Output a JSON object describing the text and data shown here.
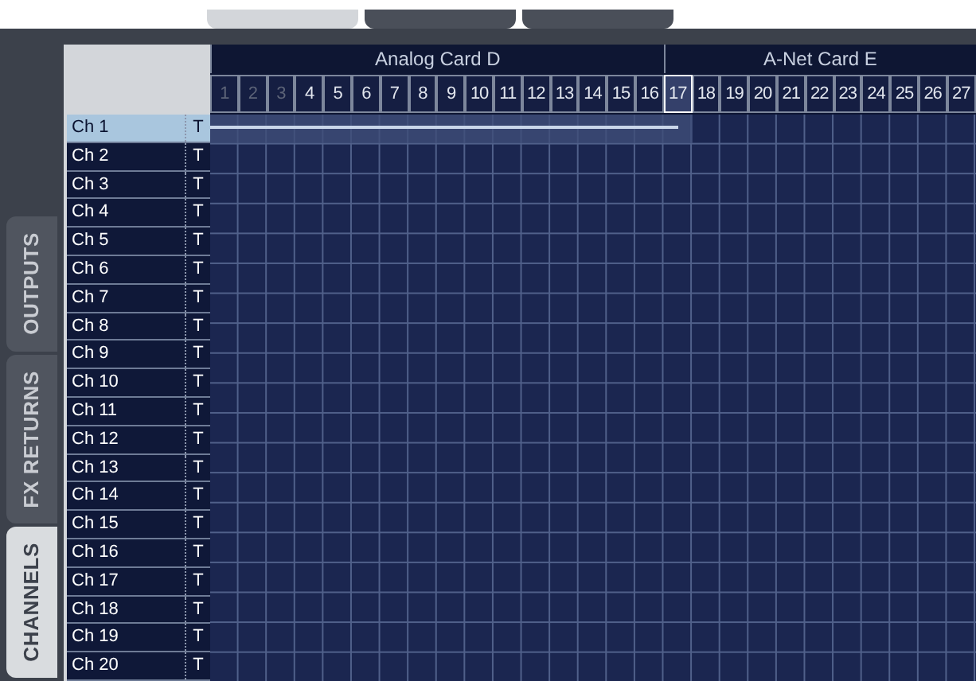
{
  "top_tabs": [
    {
      "selected": true
    },
    {
      "selected": false
    },
    {
      "selected": false
    }
  ],
  "side_tabs": [
    {
      "label": "OUTPUTS",
      "selected": false
    },
    {
      "label": "FX RETURNS",
      "selected": false
    },
    {
      "label": "CHANNELS",
      "selected": true
    }
  ],
  "cards": [
    {
      "label": "Analog Card D",
      "columns": [
        {
          "label": "1",
          "disabled": true,
          "selected": false
        },
        {
          "label": "2",
          "disabled": true,
          "selected": false
        },
        {
          "label": "3",
          "disabled": true,
          "selected": false
        },
        {
          "label": "4",
          "disabled": false,
          "selected": false
        },
        {
          "label": "5",
          "disabled": false,
          "selected": false
        },
        {
          "label": "6",
          "disabled": false,
          "selected": false
        },
        {
          "label": "7",
          "disabled": false,
          "selected": false
        },
        {
          "label": "8",
          "disabled": false,
          "selected": false
        },
        {
          "label": "9",
          "disabled": false,
          "selected": false
        },
        {
          "label": "10",
          "disabled": false,
          "selected": false
        },
        {
          "label": "11",
          "disabled": false,
          "selected": false
        },
        {
          "label": "12",
          "disabled": false,
          "selected": false
        },
        {
          "label": "13",
          "disabled": false,
          "selected": false
        },
        {
          "label": "14",
          "disabled": false,
          "selected": false
        },
        {
          "label": "15",
          "disabled": false,
          "selected": false
        },
        {
          "label": "16",
          "disabled": false,
          "selected": false
        }
      ]
    },
    {
      "label": "A-Net Card E",
      "columns": [
        {
          "label": "17",
          "disabled": false,
          "selected": true
        },
        {
          "label": "18",
          "disabled": false,
          "selected": false
        },
        {
          "label": "19",
          "disabled": false,
          "selected": false
        },
        {
          "label": "20",
          "disabled": false,
          "selected": false
        },
        {
          "label": "21",
          "disabled": false,
          "selected": false
        },
        {
          "label": "22",
          "disabled": false,
          "selected": false
        },
        {
          "label": "23",
          "disabled": false,
          "selected": false
        },
        {
          "label": "24",
          "disabled": false,
          "selected": false
        },
        {
          "label": "25",
          "disabled": false,
          "selected": false
        },
        {
          "label": "26",
          "disabled": false,
          "selected": false
        },
        {
          "label": "27",
          "disabled": false,
          "selected": false
        }
      ]
    }
  ],
  "rows": [
    {
      "label": "Ch 1",
      "tag": "T",
      "selected": true
    },
    {
      "label": "Ch 2",
      "tag": "T",
      "selected": false
    },
    {
      "label": "Ch 3",
      "tag": "T",
      "selected": false
    },
    {
      "label": "Ch 4",
      "tag": "T",
      "selected": false
    },
    {
      "label": "Ch 5",
      "tag": "T",
      "selected": false
    },
    {
      "label": "Ch 6",
      "tag": "T",
      "selected": false
    },
    {
      "label": "Ch 7",
      "tag": "T",
      "selected": false
    },
    {
      "label": "Ch 8",
      "tag": "T",
      "selected": false
    },
    {
      "label": "Ch 9",
      "tag": "T",
      "selected": false
    },
    {
      "label": "Ch 10",
      "tag": "T",
      "selected": false
    },
    {
      "label": "Ch 11",
      "tag": "T",
      "selected": false
    },
    {
      "label": "Ch 12",
      "tag": "T",
      "selected": false
    },
    {
      "label": "Ch 13",
      "tag": "T",
      "selected": false
    },
    {
      "label": "Ch 14",
      "tag": "T",
      "selected": false
    },
    {
      "label": "Ch 15",
      "tag": "T",
      "selected": false
    },
    {
      "label": "Ch 16",
      "tag": "T",
      "selected": false
    },
    {
      "label": "Ch 17",
      "tag": "T",
      "selected": false
    },
    {
      "label": "Ch 18",
      "tag": "T",
      "selected": false
    },
    {
      "label": "Ch 19",
      "tag": "T",
      "selected": false
    },
    {
      "label": "Ch 20",
      "tag": "T",
      "selected": false
    }
  ]
}
